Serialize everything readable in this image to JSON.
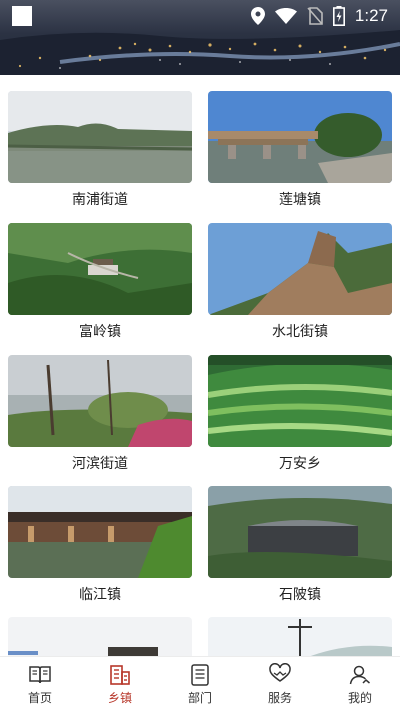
{
  "status_bar": {
    "time": "1:27",
    "icons": [
      "location-icon",
      "wifi-icon",
      "no-sim-icon",
      "battery-charging-icon"
    ]
  },
  "banner": {
    "description_icon": "city-night-banner"
  },
  "towns": [
    {
      "name": "南浦街道"
    },
    {
      "name": "莲塘镇"
    },
    {
      "name": "富岭镇"
    },
    {
      "name": "水北街镇"
    },
    {
      "name": "河滨街道"
    },
    {
      "name": "万安乡"
    },
    {
      "name": "临江镇"
    },
    {
      "name": "石陂镇"
    }
  ],
  "tabbar": {
    "items": [
      {
        "label": "首页",
        "icon": "book-icon"
      },
      {
        "label": "乡镇",
        "icon": "building-icon",
        "active": true
      },
      {
        "label": "部门",
        "icon": "document-icon"
      },
      {
        "label": "服务",
        "icon": "heart-hands-icon"
      },
      {
        "label": "我的",
        "icon": "user-icon"
      }
    ]
  },
  "colors": {
    "accent": "#b7372a",
    "text": "#222222"
  }
}
